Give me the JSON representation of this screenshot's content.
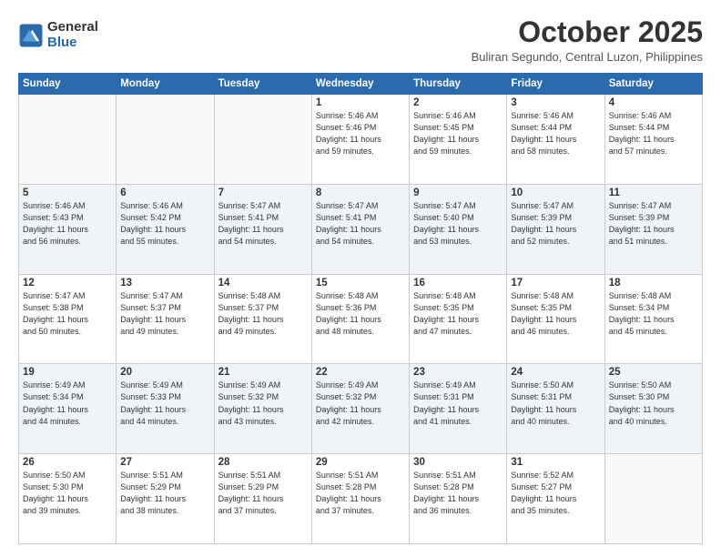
{
  "header": {
    "logo_general": "General",
    "logo_blue": "Blue",
    "month": "October 2025",
    "location": "Buliran Segundo, Central Luzon, Philippines"
  },
  "days_of_week": [
    "Sunday",
    "Monday",
    "Tuesday",
    "Wednesday",
    "Thursday",
    "Friday",
    "Saturday"
  ],
  "weeks": [
    [
      {
        "day": "",
        "info": ""
      },
      {
        "day": "",
        "info": ""
      },
      {
        "day": "",
        "info": ""
      },
      {
        "day": "1",
        "info": "Sunrise: 5:46 AM\nSunset: 5:46 PM\nDaylight: 11 hours\nand 59 minutes."
      },
      {
        "day": "2",
        "info": "Sunrise: 5:46 AM\nSunset: 5:45 PM\nDaylight: 11 hours\nand 59 minutes."
      },
      {
        "day": "3",
        "info": "Sunrise: 5:46 AM\nSunset: 5:44 PM\nDaylight: 11 hours\nand 58 minutes."
      },
      {
        "day": "4",
        "info": "Sunrise: 5:46 AM\nSunset: 5:44 PM\nDaylight: 11 hours\nand 57 minutes."
      }
    ],
    [
      {
        "day": "5",
        "info": "Sunrise: 5:46 AM\nSunset: 5:43 PM\nDaylight: 11 hours\nand 56 minutes."
      },
      {
        "day": "6",
        "info": "Sunrise: 5:46 AM\nSunset: 5:42 PM\nDaylight: 11 hours\nand 55 minutes."
      },
      {
        "day": "7",
        "info": "Sunrise: 5:47 AM\nSunset: 5:41 PM\nDaylight: 11 hours\nand 54 minutes."
      },
      {
        "day": "8",
        "info": "Sunrise: 5:47 AM\nSunset: 5:41 PM\nDaylight: 11 hours\nand 54 minutes."
      },
      {
        "day": "9",
        "info": "Sunrise: 5:47 AM\nSunset: 5:40 PM\nDaylight: 11 hours\nand 53 minutes."
      },
      {
        "day": "10",
        "info": "Sunrise: 5:47 AM\nSunset: 5:39 PM\nDaylight: 11 hours\nand 52 minutes."
      },
      {
        "day": "11",
        "info": "Sunrise: 5:47 AM\nSunset: 5:39 PM\nDaylight: 11 hours\nand 51 minutes."
      }
    ],
    [
      {
        "day": "12",
        "info": "Sunrise: 5:47 AM\nSunset: 5:38 PM\nDaylight: 11 hours\nand 50 minutes."
      },
      {
        "day": "13",
        "info": "Sunrise: 5:47 AM\nSunset: 5:37 PM\nDaylight: 11 hours\nand 49 minutes."
      },
      {
        "day": "14",
        "info": "Sunrise: 5:48 AM\nSunset: 5:37 PM\nDaylight: 11 hours\nand 49 minutes."
      },
      {
        "day": "15",
        "info": "Sunrise: 5:48 AM\nSunset: 5:36 PM\nDaylight: 11 hours\nand 48 minutes."
      },
      {
        "day": "16",
        "info": "Sunrise: 5:48 AM\nSunset: 5:35 PM\nDaylight: 11 hours\nand 47 minutes."
      },
      {
        "day": "17",
        "info": "Sunrise: 5:48 AM\nSunset: 5:35 PM\nDaylight: 11 hours\nand 46 minutes."
      },
      {
        "day": "18",
        "info": "Sunrise: 5:48 AM\nSunset: 5:34 PM\nDaylight: 11 hours\nand 45 minutes."
      }
    ],
    [
      {
        "day": "19",
        "info": "Sunrise: 5:49 AM\nSunset: 5:34 PM\nDaylight: 11 hours\nand 44 minutes."
      },
      {
        "day": "20",
        "info": "Sunrise: 5:49 AM\nSunset: 5:33 PM\nDaylight: 11 hours\nand 44 minutes."
      },
      {
        "day": "21",
        "info": "Sunrise: 5:49 AM\nSunset: 5:32 PM\nDaylight: 11 hours\nand 43 minutes."
      },
      {
        "day": "22",
        "info": "Sunrise: 5:49 AM\nSunset: 5:32 PM\nDaylight: 11 hours\nand 42 minutes."
      },
      {
        "day": "23",
        "info": "Sunrise: 5:49 AM\nSunset: 5:31 PM\nDaylight: 11 hours\nand 41 minutes."
      },
      {
        "day": "24",
        "info": "Sunrise: 5:50 AM\nSunset: 5:31 PM\nDaylight: 11 hours\nand 40 minutes."
      },
      {
        "day": "25",
        "info": "Sunrise: 5:50 AM\nSunset: 5:30 PM\nDaylight: 11 hours\nand 40 minutes."
      }
    ],
    [
      {
        "day": "26",
        "info": "Sunrise: 5:50 AM\nSunset: 5:30 PM\nDaylight: 11 hours\nand 39 minutes."
      },
      {
        "day": "27",
        "info": "Sunrise: 5:51 AM\nSunset: 5:29 PM\nDaylight: 11 hours\nand 38 minutes."
      },
      {
        "day": "28",
        "info": "Sunrise: 5:51 AM\nSunset: 5:29 PM\nDaylight: 11 hours\nand 37 minutes."
      },
      {
        "day": "29",
        "info": "Sunrise: 5:51 AM\nSunset: 5:28 PM\nDaylight: 11 hours\nand 37 minutes."
      },
      {
        "day": "30",
        "info": "Sunrise: 5:51 AM\nSunset: 5:28 PM\nDaylight: 11 hours\nand 36 minutes."
      },
      {
        "day": "31",
        "info": "Sunrise: 5:52 AM\nSunset: 5:27 PM\nDaylight: 11 hours\nand 35 minutes."
      },
      {
        "day": "",
        "info": ""
      }
    ]
  ]
}
